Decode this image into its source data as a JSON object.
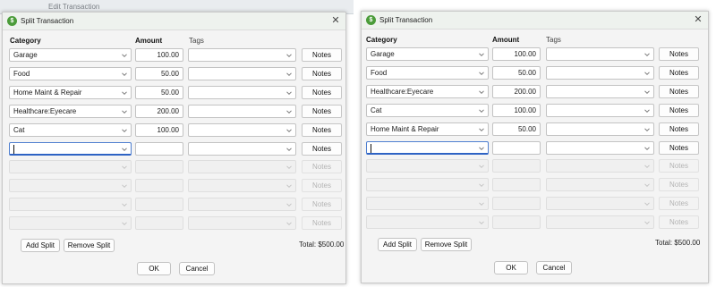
{
  "background_window": {
    "title": "Edit Transaction"
  },
  "dialogs": [
    {
      "title": "Split Transaction",
      "headers": {
        "category": "Category",
        "amount": "Amount",
        "tags": "Tags"
      },
      "rows": [
        {
          "category": "Garage",
          "amount": "100.00",
          "tags": "",
          "notes": "Notes",
          "state": "filled"
        },
        {
          "category": "Food",
          "amount": "50.00",
          "tags": "",
          "notes": "Notes",
          "state": "filled"
        },
        {
          "category": "Home Maint & Repair",
          "amount": "50.00",
          "tags": "",
          "notes": "Notes",
          "state": "filled"
        },
        {
          "category": "Healthcare:Eyecare",
          "amount": "200.00",
          "tags": "",
          "notes": "Notes",
          "state": "filled"
        },
        {
          "category": "Cat",
          "amount": "100.00",
          "tags": "",
          "notes": "Notes",
          "state": "filled"
        },
        {
          "category": "",
          "amount": "",
          "tags": "",
          "notes": "Notes",
          "state": "active"
        },
        {
          "category": "",
          "amount": "",
          "tags": "",
          "notes": "Notes",
          "state": "disabled"
        },
        {
          "category": "",
          "amount": "",
          "tags": "",
          "notes": "Notes",
          "state": "disabled"
        },
        {
          "category": "",
          "amount": "",
          "tags": "",
          "notes": "Notes",
          "state": "disabled"
        },
        {
          "category": "",
          "amount": "",
          "tags": "",
          "notes": "Notes",
          "state": "disabled"
        }
      ],
      "add_split": "Add Split",
      "remove_split": "Remove Split",
      "total": "Total:  $500.00",
      "ok": "OK",
      "cancel": "Cancel"
    },
    {
      "title": "Split Transaction",
      "headers": {
        "category": "Category",
        "amount": "Amount",
        "tags": "Tags"
      },
      "rows": [
        {
          "category": "Garage",
          "amount": "100.00",
          "tags": "",
          "notes": "Notes",
          "state": "filled"
        },
        {
          "category": "Food",
          "amount": "50.00",
          "tags": "",
          "notes": "Notes",
          "state": "filled"
        },
        {
          "category": "Healthcare:Eyecare",
          "amount": "200.00",
          "tags": "",
          "notes": "Notes",
          "state": "filled"
        },
        {
          "category": "Cat",
          "amount": "100.00",
          "tags": "",
          "notes": "Notes",
          "state": "filled"
        },
        {
          "category": "Home Maint & Repair",
          "amount": "50.00",
          "tags": "",
          "notes": "Notes",
          "state": "filled"
        },
        {
          "category": "",
          "amount": "",
          "tags": "",
          "notes": "Notes",
          "state": "active"
        },
        {
          "category": "",
          "amount": "",
          "tags": "",
          "notes": "Notes",
          "state": "disabled"
        },
        {
          "category": "",
          "amount": "",
          "tags": "",
          "notes": "Notes",
          "state": "disabled"
        },
        {
          "category": "",
          "amount": "",
          "tags": "",
          "notes": "Notes",
          "state": "disabled"
        },
        {
          "category": "",
          "amount": "",
          "tags": "",
          "notes": "Notes",
          "state": "disabled"
        }
      ],
      "add_split": "Add Split",
      "remove_split": "Remove Split",
      "total": "Total:  $500.00",
      "ok": "OK",
      "cancel": "Cancel"
    }
  ],
  "icons": {
    "app": "app-logo-icon",
    "close": "close-icon",
    "dropdown": "chevron-down-icon"
  },
  "colors": {
    "app_icon": "#4b9c3a",
    "active_border": "#2e63c4",
    "titlebar": "#eef2ee"
  }
}
